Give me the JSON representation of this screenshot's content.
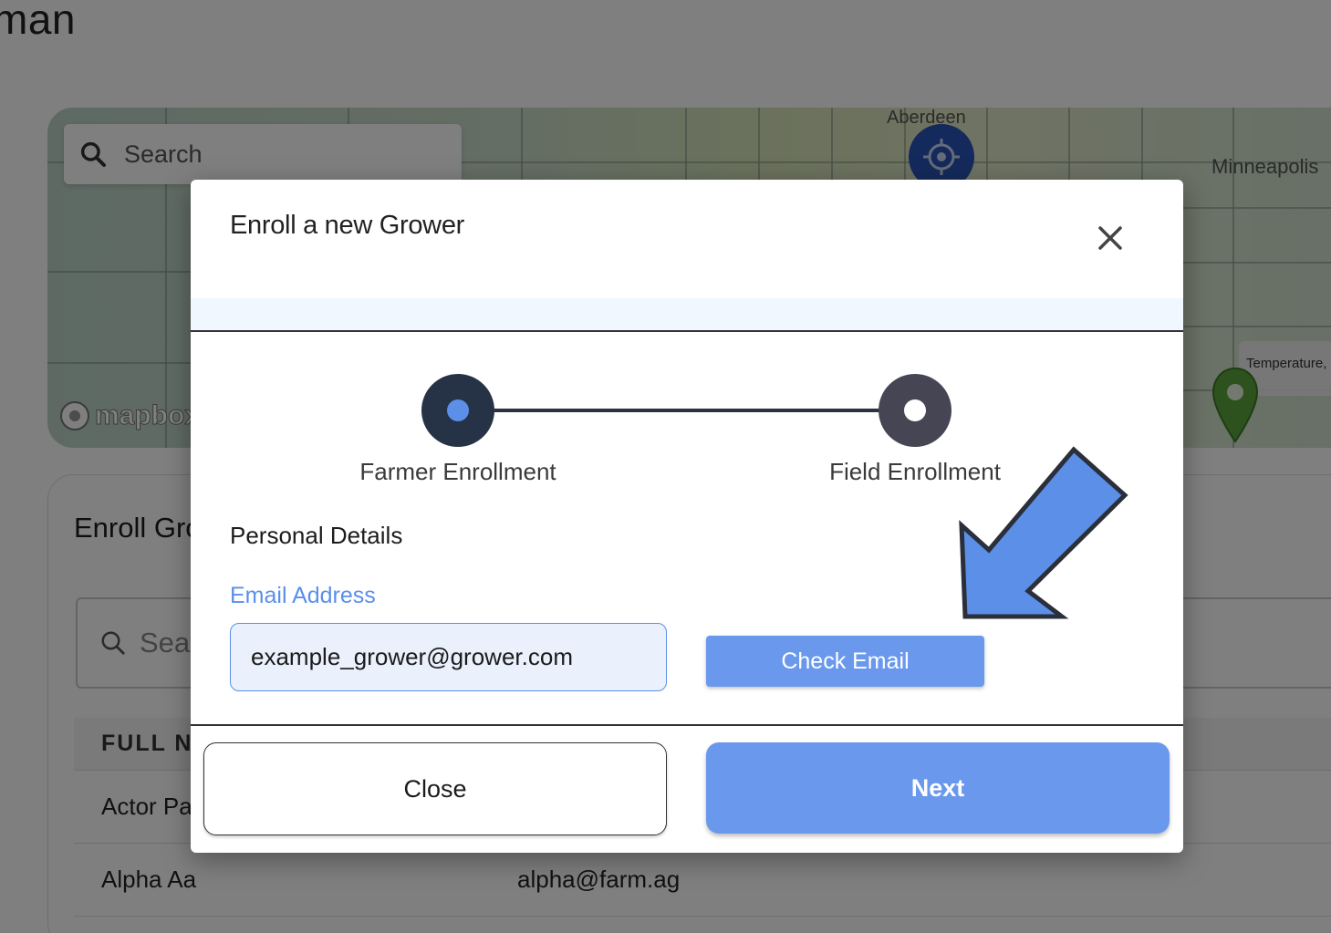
{
  "page": {
    "title": "man"
  },
  "map": {
    "search_placeholder": "Search",
    "labels": {
      "aberdeen": "Aberdeen",
      "minneapolis": "Minneapolis",
      "temperature": "Temperature, °"
    },
    "attribution": "mapbox"
  },
  "panel": {
    "title": "Enroll Gro",
    "search_placeholder": "Sea",
    "table": {
      "header": "FULL NA",
      "rows": [
        {
          "name": "Actor Pa",
          "email": ""
        },
        {
          "name": "Alpha Aa",
          "email": "alpha@farm.ag"
        }
      ]
    }
  },
  "modal": {
    "title": "Enroll a new Grower",
    "steps": [
      {
        "label": "Farmer Enrollment",
        "state": "active"
      },
      {
        "label": "Field Enrollment",
        "state": "pending"
      }
    ],
    "section_title": "Personal Details",
    "email_label": "Email Address",
    "email_value": "example_grower@grower.com",
    "check_email_label": "Check Email",
    "close_label": "Close",
    "next_label": "Next"
  },
  "colors": {
    "accent": "#6a98ec",
    "step_active": "#263245",
    "step_pending": "#454553",
    "overlay": "rgba(0,0,0,0.5)",
    "annotation_arrow": "#5b8fe8"
  }
}
